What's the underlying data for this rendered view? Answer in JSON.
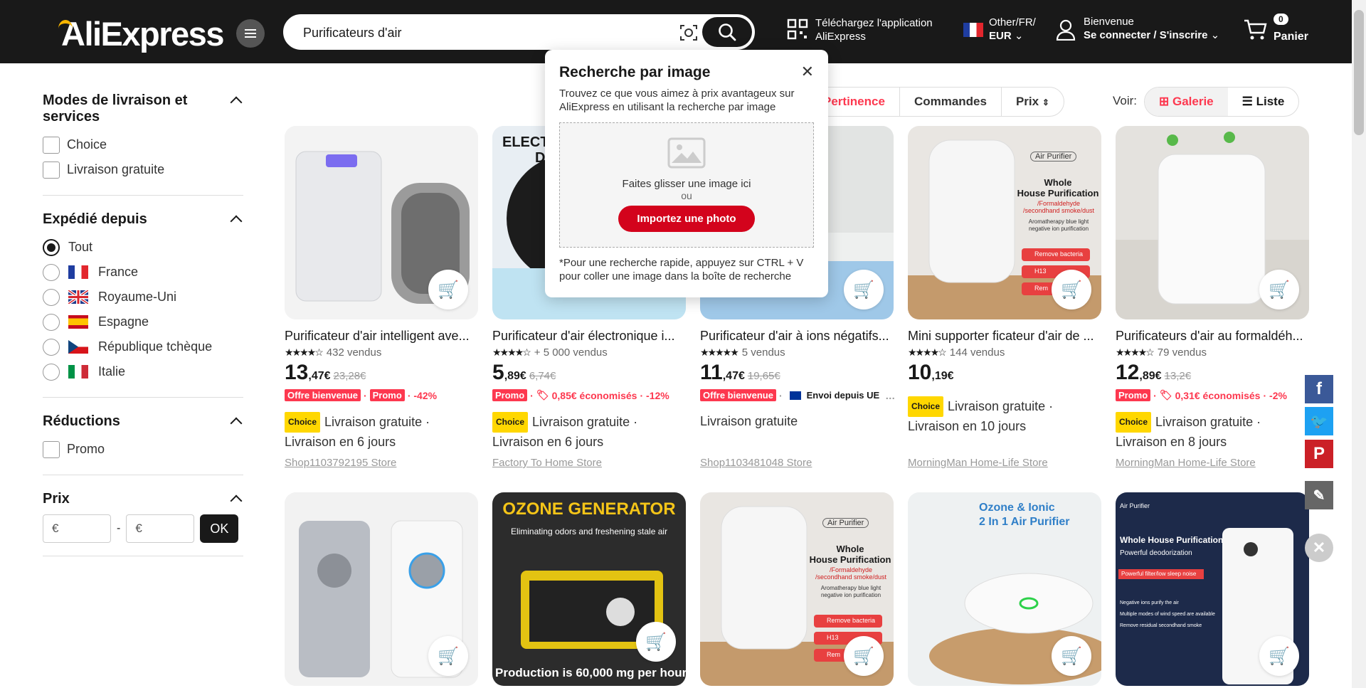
{
  "header": {
    "logo": "AliExpress",
    "search_value": "Purificateurs d'air",
    "app_line1": "Téléchargez l'application",
    "app_line2": "AliExpress",
    "region_line1": "Other/FR/",
    "region_line2": "EUR",
    "account_line1": "Bienvenue",
    "account_line2": "Se connecter / S'inscrire",
    "cart_count": "0",
    "cart_label": "Panier"
  },
  "sidebar": {
    "delivery": {
      "title": "Modes de livraison et services",
      "options": [
        "Choice",
        "Livraison gratuite"
      ]
    },
    "shipped_from": {
      "title": "Expédié depuis",
      "options": [
        "Tout",
        "France",
        "Royaume-Uni",
        "Espagne",
        "République tchèque",
        "Italie"
      ]
    },
    "reductions": {
      "title": "Réductions",
      "options": [
        "Promo"
      ]
    },
    "price": {
      "title": "Prix",
      "min_placeholder": "€",
      "max_placeholder": "€",
      "separator": "-",
      "ok": "OK"
    }
  },
  "sort": {
    "pertinence": "Pertinence",
    "commandes": "Commandes",
    "prix": "Prix"
  },
  "view": {
    "label": "Voir:",
    "galerie": "Galerie",
    "liste": "Liste"
  },
  "popup": {
    "title": "Recherche par image",
    "desc": "Trouvez ce que vous aimez à prix avantageux sur AliExpress en utilisant la recherche par image",
    "drop": "Faites glisser une image ici",
    "or": "ou",
    "button": "Importez une photo",
    "note": "*Pour une recherche rapide, appuyez sur CTRL + V pour coller une image dans la boîte de recherche"
  },
  "products": [
    {
      "title": "Purificateur d'air intelligent ave...",
      "sold": "432 vendus",
      "price_int": "13",
      "price_dec": ",47€",
      "old": "23,28€",
      "badge1": "Offre bienvenue",
      "badge2": "Promo",
      "discount": "· -42%",
      "choice": "Choice",
      "ship": "Livraison gratuite ·",
      "ship2": "Livraison en 6 jours",
      "store": "Shop1103792195 Store"
    },
    {
      "title": "Purificateur d'air électronique i...",
      "sold": "+ 5 000 vendus",
      "price_int": "5",
      "price_dec": ",89€",
      "old": "6,74€",
      "badge1": "Promo",
      "saving": "0,85€ économisés",
      "discount": "· -12%",
      "choice": "Choice",
      "ship": "Livraison gratuite ·",
      "ship2": "Livraison en 6 jours",
      "store": "Factory To Home Store"
    },
    {
      "title": "Purificateur d'air à ions négatifs...",
      "sold": "5 vendus",
      "price_int": "11",
      "price_dec": ",47€",
      "old": "19,65€",
      "badge1": "Offre bienvenue",
      "eu": "Envoi depuis UE",
      "ship": "Livraison gratuite",
      "store": "Shop1103481048 Store"
    },
    {
      "title": "Mini supporter ficateur d'air de ...",
      "sold": "144 vendus",
      "price_int": "10",
      "price_dec": ",19€",
      "choice": "Choice",
      "ship": "Livraison gratuite ·",
      "ship2": "Livraison en 10 jours",
      "store": "MorningMan Home-Life Store"
    },
    {
      "title": "Purificateurs d'air au formaldéh...",
      "sold": "79 vendus",
      "price_int": "12",
      "price_dec": ",89€",
      "old": "13,2€",
      "badge1": "Promo",
      "saving": "0,31€ économisés",
      "discount": "· -2%",
      "choice": "Choice",
      "ship": "Livraison gratuite ·",
      "ship2": "Livraison en 8 jours",
      "store": "MorningMan Home-Life Store"
    }
  ],
  "images": {
    "p2": "ELECT",
    "p2b": "D",
    "p4_tag": "Air Purifier",
    "p4_l1": "Whole",
    "p4_l2": "House Purification",
    "p4_l3": "/Formaldehyde /secondhand smoke/dust",
    "p4_l4": "Aromatherapy blue light negative ion purification",
    "p4_b1": "Remove bacteria",
    "p4_b2": "H13",
    "p4_b3": "Rem",
    "r2_title": "OZONE GENERATOR",
    "r2_sub": "Eliminating odors and freshening stale air",
    "r2_bottom": "Production is 60,000 mg per hour",
    "r4_l1": "Ozone & Ionic",
    "r4_l2": "2 In 1 Air Purifier",
    "r5_tag": "Air Purifier",
    "r5_l1": "Whole House Purification",
    "r5_l2": "Powerful deodorization",
    "r5_l3": "Powerful filter/low sleep noise",
    "r5_b1": "Negative ions purify the air",
    "r5_b2": "Multiple modes of wind speed are available",
    "r5_b3": "Remove residual secondhand smoke"
  },
  "colors": {
    "accent": "#fd384f",
    "header": "#191919",
    "choice": "#ffd700",
    "upload": "#d3031c"
  }
}
